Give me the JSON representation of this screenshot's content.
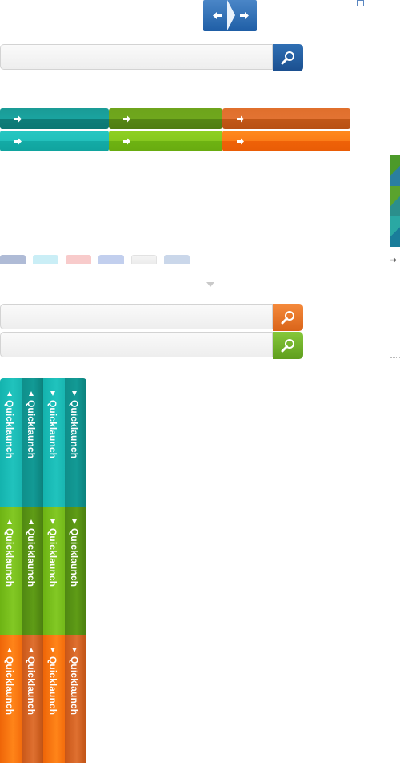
{
  "nav": {
    "prev_icon": "arrow-left-icon",
    "next_icon": "arrow-right-icon"
  },
  "search_bars": [
    {
      "value": "",
      "placeholder": "",
      "button_icon": "search-icon",
      "color": "#1f5ea6"
    },
    {
      "value": "",
      "placeholder": "",
      "button_icon": "search-icon",
      "color": "#e06a1f"
    },
    {
      "value": "",
      "placeholder": "",
      "button_icon": "search-icon",
      "color": "#6fae22"
    }
  ],
  "link_bars": {
    "icon": "arrow-right-icon",
    "colors": {
      "teal": "#14aba6",
      "green": "#6eb312",
      "orange": "#ef6208"
    }
  },
  "social_icons": [
    "facebook-icon",
    "twitter-icon",
    "youtube-icon",
    "myspace-icon",
    "email-icon",
    "more-icon"
  ],
  "quicklaunch": {
    "label": "Quicklaunch",
    "colors": {
      "teal": "#1ab9b4",
      "green": "#74b91a",
      "orange": "#f4700f"
    }
  }
}
